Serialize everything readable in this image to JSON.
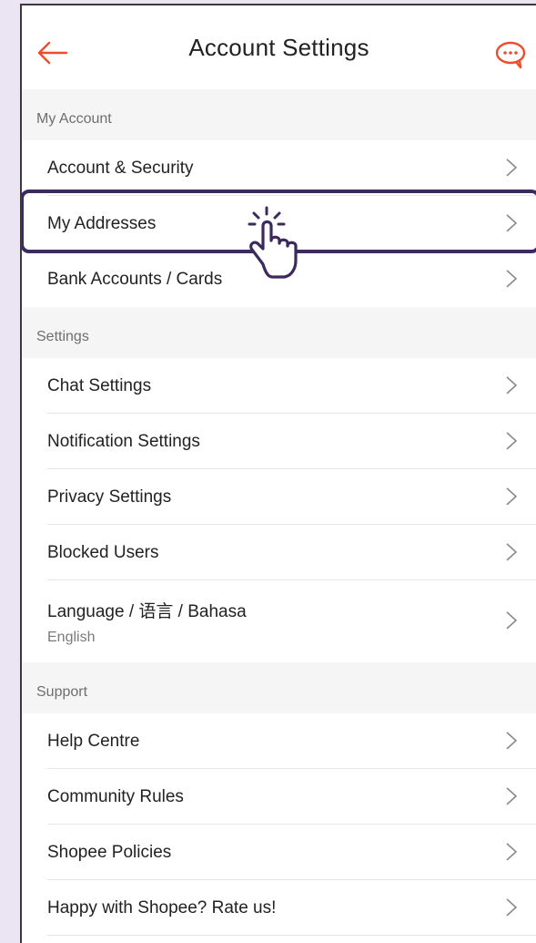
{
  "header": {
    "title": "Account Settings"
  },
  "colors": {
    "accent": "#ee4d2d",
    "highlight": "#3c2a5e",
    "background": "#ebe4f3"
  },
  "icons": {
    "back": "back-arrow-icon",
    "chat": "chat-bubble-icon",
    "chevron": "chevron-right-icon",
    "pointer": "hand-pointer-icon"
  },
  "sections": {
    "my_account": {
      "title": "My Account",
      "items": [
        "Account & Security",
        "My Addresses",
        "Bank Accounts / Cards"
      ]
    },
    "settings": {
      "title": "Settings",
      "items": [
        "Chat Settings",
        "Notification Settings",
        "Privacy Settings",
        "Blocked Users"
      ],
      "language": {
        "label": "Language / 语言 / Bahasa",
        "value": "English"
      }
    },
    "support": {
      "title": "Support",
      "items": [
        "Help Centre",
        "Community Rules",
        "Shopee Policies",
        "Happy with Shopee? Rate us!"
      ]
    }
  }
}
